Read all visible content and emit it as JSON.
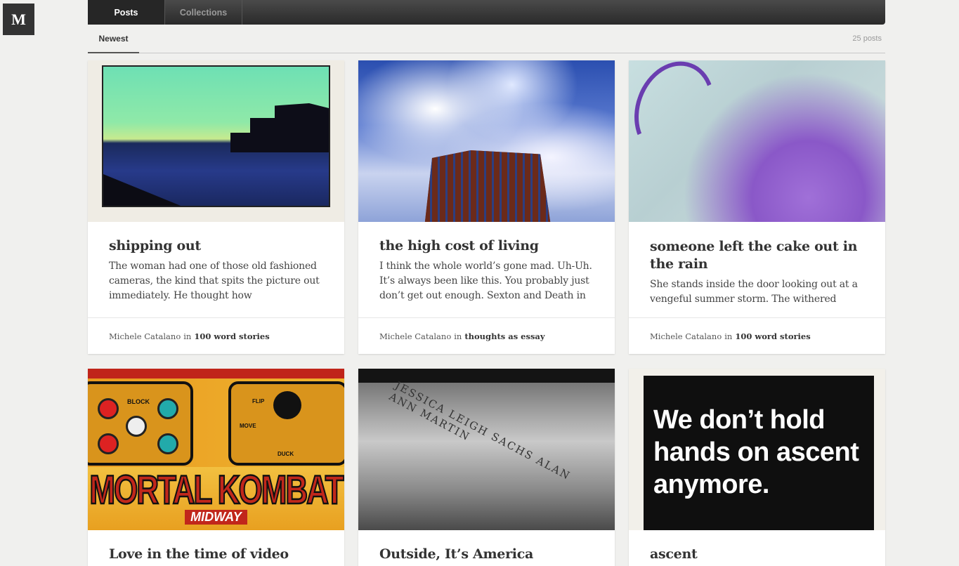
{
  "logo": {
    "text": "M"
  },
  "tabs": [
    {
      "label": "Posts",
      "active": true
    },
    {
      "label": "Collections",
      "active": false
    }
  ],
  "subnav": {
    "sort_label": "Newest",
    "count": "25 posts"
  },
  "posts": [
    {
      "title": "shipping out",
      "excerpt": "The woman had one of those old fashioned cameras, the kind that spits the picture out immediately. He thought how simultaneously",
      "author": "Michele Catalano",
      "in": "in",
      "collection": "100 word stories",
      "image": "harbor-sunset-photo"
    },
    {
      "title": "the high cost of living",
      "excerpt": "I think the whole world’s gone mad. Uh-Uh. It’s always been like this. You probably just don’t get out enough. Sexton and Death in Neil",
      "author": "Michele Catalano",
      "in": "in",
      "collection": "thoughts as essay",
      "image": "brick-tower-clouds-photo"
    },
    {
      "title": "someone left the cake out in the rain",
      "excerpt": "She stands inside the door looking out at a vengeful summer storm. The withered",
      "author": "Michele Catalano",
      "in": "in",
      "collection": "100 word stories",
      "image": "purple-balloon-photo"
    },
    {
      "title": "Love in the time of video games",
      "image": "arcade-panel-photo",
      "image_text": {
        "top_left": "BLOCK",
        "top_mid_1": "FLIP",
        "top_mid_2": "MOVE",
        "top_mid_3": "DUCK",
        "logo": "MORTAL KOMBAT",
        "brand": "MIDWAY"
      }
    },
    {
      "title": "Outside, It’s America",
      "image": "memorial-names-photo",
      "image_text": {
        "names": "JESSICA LEIGH SACHS    ALAN ANN MARTIN"
      }
    },
    {
      "title": "ascent",
      "image": "sign-photo",
      "image_text": {
        "line1": "We don’t hold",
        "line2": "hands on ascent",
        "line3": "anymore."
      }
    }
  ]
}
